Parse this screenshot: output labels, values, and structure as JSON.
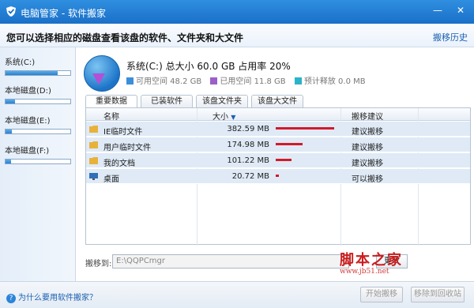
{
  "window": {
    "title": "电脑管家 - 软件搬家",
    "minimize": "—",
    "close": "✕"
  },
  "header": {
    "headline": "您可以选择相应的磁盘查看该盘的软件、文件夹和大文件",
    "history_link": "搬移历史"
  },
  "sidebar": {
    "drives": [
      {
        "label": "系统(C:)",
        "usage": 0.8
      },
      {
        "label": "本地磁盘(D:)",
        "usage": 0.15
      },
      {
        "label": "本地磁盘(E:)",
        "usage": 0.1
      },
      {
        "label": "本地磁盘(F:)",
        "usage": 0.08
      }
    ]
  },
  "disk": {
    "title": "系统(C:) 总大小 60.0 GB   占用率 20%",
    "legend": [
      {
        "label": "可用空间 48.2 GB",
        "color": "#3b8fd9"
      },
      {
        "label": "已用空间 11.8 GB",
        "color": "#9b5fc9"
      },
      {
        "label": "预计释放 0.0 MB",
        "color": "#2ab3c9"
      }
    ]
  },
  "tabs": [
    "重要数据",
    "已装软件",
    "该盘文件夹",
    "该盘大文件"
  ],
  "table": {
    "headers": {
      "name": "名称",
      "size": "大小",
      "advice": "搬移建议"
    },
    "rows": [
      {
        "name": "IE临时文件",
        "size": "382.59 MB",
        "advice": "建议搬移",
        "ratio": 1.0,
        "icon": "folder-icon"
      },
      {
        "name": "用户临时文件",
        "size": "174.98 MB",
        "advice": "建议搬移",
        "ratio": 0.46,
        "icon": "folder-icon"
      },
      {
        "name": "我的文档",
        "size": "101.22 MB",
        "advice": "建议搬移",
        "ratio": 0.27,
        "icon": "folder-icon"
      },
      {
        "name": "桌面",
        "size": "20.72 MB",
        "advice": "可以搬移",
        "ratio": 0.05,
        "icon": "desktop-icon"
      }
    ]
  },
  "move": {
    "label": "搬移到:",
    "path": "E:\\QQPCmgr",
    "change_button": "更改"
  },
  "watermark": {
    "line1": "脚本之家",
    "line2": "www.jb51.net"
  },
  "footer": {
    "help_link": "为什么要用软件搬家？",
    "start_button": "开始搬移",
    "recycle_button": "移除到回收站"
  }
}
